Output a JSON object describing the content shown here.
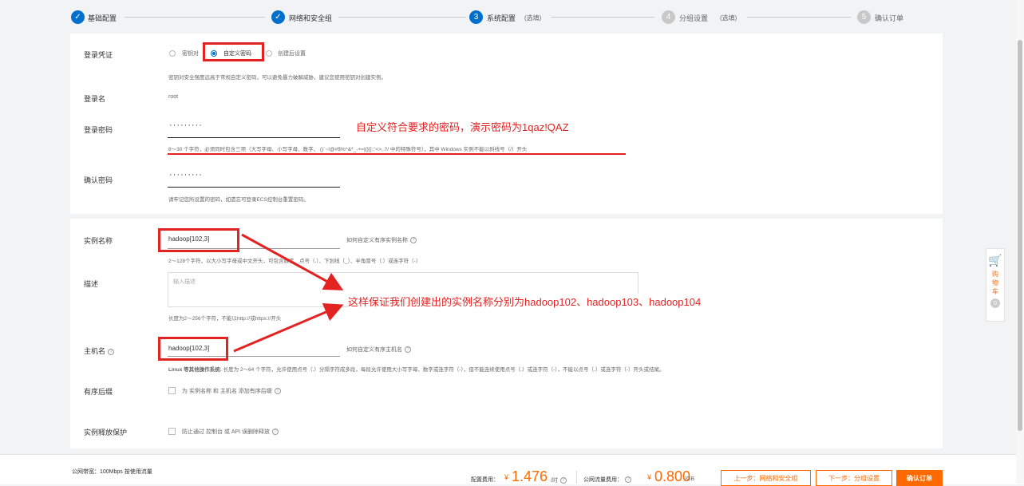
{
  "steps": [
    {
      "num": "✓",
      "label": "基础配置",
      "optional": "",
      "state": "done"
    },
    {
      "num": "✓",
      "label": "网络和安全组",
      "optional": "",
      "state": "done"
    },
    {
      "num": "3",
      "label": "系统配置",
      "optional": "(选填)",
      "state": "current"
    },
    {
      "num": "4",
      "label": "分组设置",
      "optional": "(选填)",
      "state": "todo"
    },
    {
      "num": "5",
      "label": "确认订单",
      "optional": "",
      "state": "todo"
    }
  ],
  "login": {
    "credential_label": "登录凭证",
    "options": [
      "密钥对",
      "自定义密码",
      "创建后设置"
    ],
    "selected": "自定义密码",
    "credential_hint": "密钥对安全强度远高于常规自定义密码，可以避免暴力破解威胁，建议您使用密钥对创建实例。",
    "name_label": "登录名",
    "name_value": "root",
    "password_label": "登录密码",
    "password_value": "·········",
    "password_rule": "8～30 个字符，必须同时包含三项（大写字母、小写字母、数字、 ()`~!@#$%^&*_-+=|{}[]:;'<>,.?/ 中的特殊符号），其中 Windows 实例不能以斜线号（/）开头",
    "confirm_label": "确认密码",
    "confirm_value": "·········",
    "confirm_hint": "请牢记您所设置的密码，如遗忘可登录ECS控制台重置密码。"
  },
  "annotations": {
    "password_note": "自定义符合要求的密码，演示密码为1qaz!QAZ",
    "name_note": "这样保证我们创建出的实例名称分别为hadoop102、hadoop103、hadoop104"
  },
  "instance": {
    "name_label": "实例名称",
    "name_value": "hadoop[102,3]",
    "name_help": "如何自定义有序实例名称",
    "name_rule": "2～128个字符，以大小写字母或中文开头，可包含数字、点号（.）、下划线（_）、半角冒号（:）或连字符（-）",
    "desc_label": "描述",
    "desc_placeholder": "输入描述",
    "desc_rule": "长度为2～256个字符，不能以http://或https://开头",
    "host_label": "主机名",
    "host_value": "hadoop[102,3]",
    "host_help": "如何自定义有序主机名",
    "host_rule_bold": "Linux 等其他操作系统:",
    "host_rule": " 长度为 2～64 个字符，允许使用点号（.）分隔字符成多段，每段允许使用大小写字母、数字或连字符（-），但不能连续使用点号（.）或连字符（-），不能以点号（.）或连字符（-）开头或结尾。",
    "suffix_label": "有序后缀",
    "suffix_text": "为 实例名称 和 主机名 添加有序后缀",
    "protect_label": "实例释放保护",
    "protect_text": "防止通过 控制台 或 API 误删除释放"
  },
  "footer": {
    "bandwidth": "公网带宽：100Mbps 按使用流量",
    "config_fee_label": "配置费用：",
    "config_fee_currency": "¥",
    "config_fee_value": "1.476",
    "config_fee_unit": "/时",
    "traffic_fee_label": "公网流量费用：",
    "traffic_fee_currency": "¥",
    "traffic_fee_value": "0.800",
    "traffic_fee_unit": "/GB",
    "prev_button": "上一步：网络和安全组",
    "next_button": "下一步：分组设置",
    "confirm_button": "确认订单"
  },
  "cart": {
    "label": "购物车",
    "count": "0"
  },
  "colors": {
    "accent": "#0070cc",
    "annotation": "#e32222",
    "price": "#ff6a00"
  }
}
